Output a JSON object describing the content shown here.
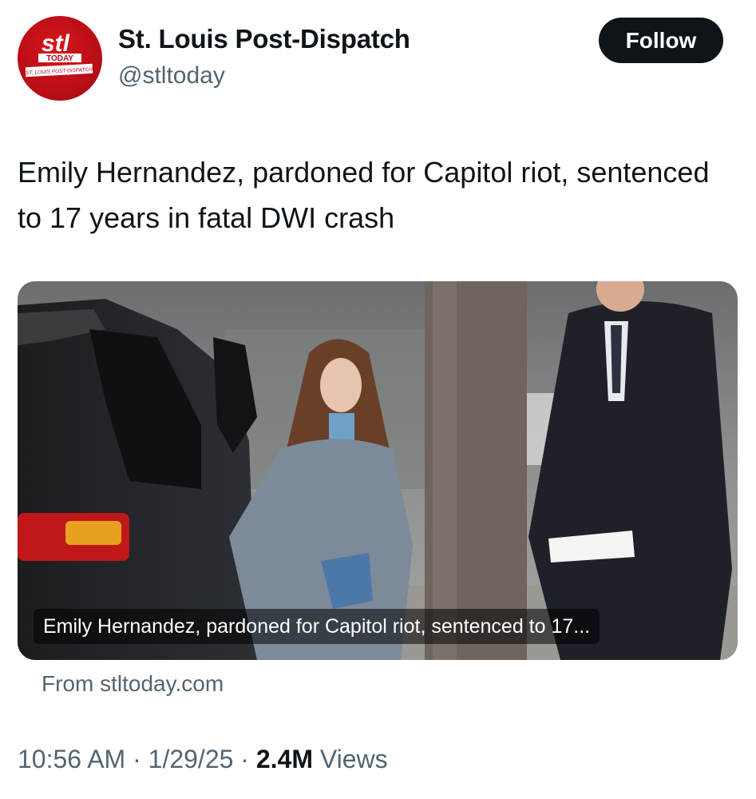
{
  "header": {
    "display_name": "St. Louis Post-Dispatch",
    "handle": "@stltoday",
    "follow_label": "Follow",
    "avatar_logo_text": "stl TODAY ST. LOUIS POST-DISPATCH"
  },
  "tweet": {
    "text": "Emily Hernandez, pardoned for Capitol riot, sentenced to 17 years in fatal DWI crash"
  },
  "card": {
    "caption": "Emily Hernandez, pardoned for Capitol riot, sentenced to 17...",
    "source": "From stltoday.com"
  },
  "meta": {
    "time": "10:56 AM",
    "sep1": " · ",
    "date": "1/29/25",
    "sep2": " · ",
    "views_count": "2.4M",
    "views_label": " Views"
  },
  "colors": {
    "follow_bg": "#0f1419",
    "secondary_text": "#536471",
    "avatar_red": "#c4111a"
  },
  "icons": [
    "stl-today-logo"
  ]
}
